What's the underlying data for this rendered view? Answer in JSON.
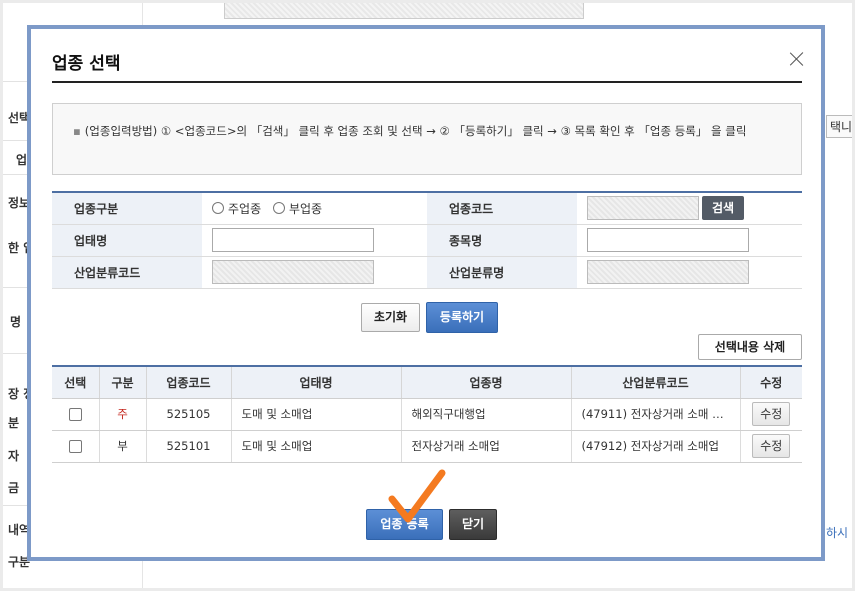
{
  "background": {
    "left_labels": [
      "선택",
      "업",
      "정보",
      "한 업",
      "명",
      "장 정",
      "분",
      "자",
      "금",
      "내역",
      "구분"
    ],
    "right_labels": [
      "택니",
      "하시"
    ]
  },
  "modal": {
    "title": "업종 선택",
    "guide_bullet": "▪",
    "guide_text": "(업종입력방법) ① <업종코드>의 「검색」 클릭 후 업종 조회 및 선택 → ② 「등록하기」 클릭 → ③ 목록 확인 후 「업종 등록」 을 클릭",
    "form": {
      "type_label": "업종구분",
      "type_options": [
        "주업종",
        "부업종"
      ],
      "code_label": "업종코드",
      "search_label": "검색",
      "business_label": "업태명",
      "item_label": "종목명",
      "industry_code_label": "산업분류코드",
      "industry_name_label": "산업분류명"
    },
    "buttons": {
      "reset": "초기화",
      "register": "등록하기",
      "delete_selected": "선택내용 삭제",
      "submit": "업종 등록",
      "close": "닫기"
    },
    "table": {
      "headers": [
        "선택",
        "구분",
        "업종코드",
        "업태명",
        "업종명",
        "산업분류코드",
        "수정"
      ],
      "edit_label": "수정",
      "rows": [
        {
          "type": "주",
          "code": "525105",
          "business": "도매 및 소매업",
          "item": "해외직구대행업",
          "industry": "(47911) 전자상거래 소매 …"
        },
        {
          "type": "부",
          "code": "525101",
          "business": "도매 및 소매업",
          "item": "전자상거래 소매업",
          "industry": "(47912) 전자상거래 소매업"
        }
      ]
    }
  },
  "colors": {
    "modal_border": "#7d9ac8",
    "primary_button": "#3a6fba",
    "dark_button": "#3a3a3a",
    "header_bg": "#edf1f7",
    "main_type_text": "#c4261d",
    "annotation_check": "#f47a20"
  }
}
